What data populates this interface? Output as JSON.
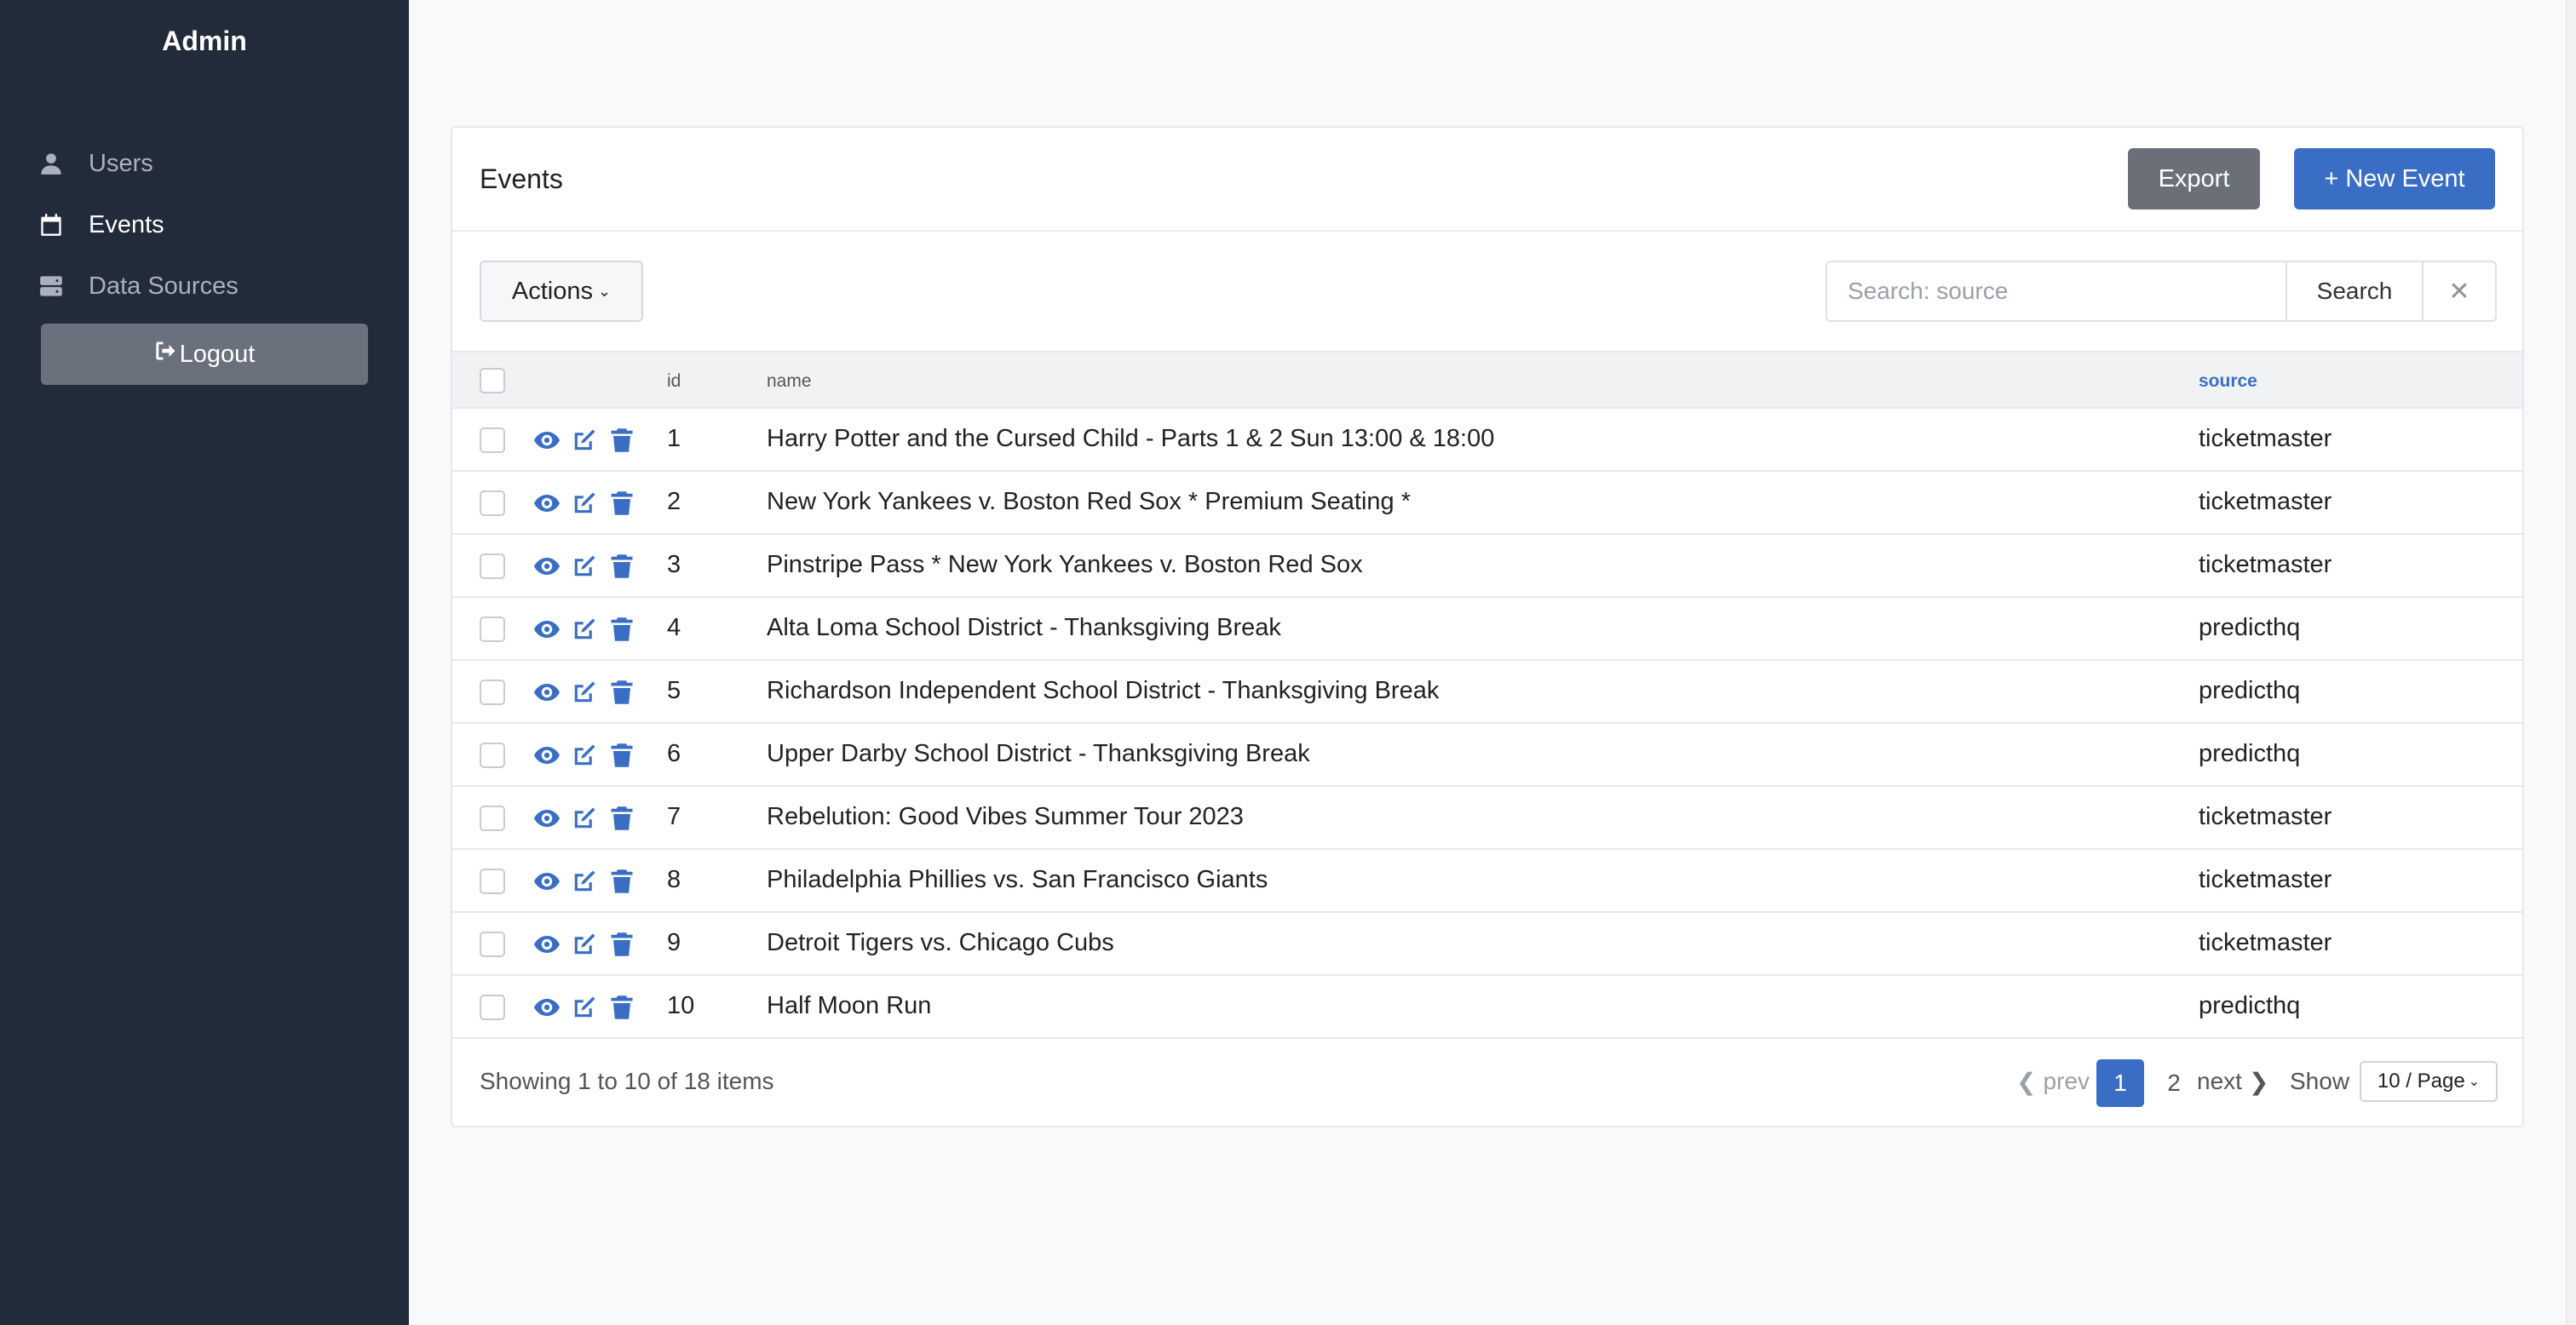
{
  "sidebar": {
    "brand": "Admin",
    "items": [
      {
        "label": "Users",
        "icon": "user-icon"
      },
      {
        "label": "Events",
        "icon": "calendar-icon"
      },
      {
        "label": "Data Sources",
        "icon": "server-icon"
      }
    ],
    "logout_label": "Logout"
  },
  "page": {
    "title": "Events",
    "export_label": "Export",
    "new_label": "+ New Event",
    "actions_label": "Actions",
    "search": {
      "placeholder": "Search: source",
      "button_label": "Search",
      "clear": "✕"
    }
  },
  "table": {
    "columns": {
      "id": "id",
      "name": "name",
      "source": "source"
    },
    "rows": [
      {
        "id": "1",
        "name": "Harry Potter and the Cursed Child - Parts 1 & 2 Sun 13:00 & 18:00",
        "source": "ticketmaster"
      },
      {
        "id": "2",
        "name": "New York Yankees v. Boston Red Sox * Premium Seating *",
        "source": "ticketmaster"
      },
      {
        "id": "3",
        "name": "Pinstripe Pass * New York Yankees v. Boston Red Sox",
        "source": "ticketmaster"
      },
      {
        "id": "4",
        "name": "Alta Loma School District - Thanksgiving Break",
        "source": "predicthq"
      },
      {
        "id": "5",
        "name": "Richardson Independent School District - Thanksgiving Break",
        "source": "predicthq"
      },
      {
        "id": "6",
        "name": "Upper Darby School District - Thanksgiving Break",
        "source": "predicthq"
      },
      {
        "id": "7",
        "name": "Rebelution: Good Vibes Summer Tour 2023",
        "source": "ticketmaster"
      },
      {
        "id": "8",
        "name": "Philadelphia Phillies vs. San Francisco Giants",
        "source": "ticketmaster"
      },
      {
        "id": "9",
        "name": "Detroit Tigers vs. Chicago Cubs",
        "source": "ticketmaster"
      },
      {
        "id": "10",
        "name": "Half Moon Run",
        "source": "predicthq"
      }
    ]
  },
  "footer": {
    "info": "Showing 1 to 10 of 18 items",
    "prev": "prev",
    "pages": [
      "1",
      "2"
    ],
    "current_page": "1",
    "next": "next",
    "show_label": "Show",
    "per_page": "10 / Page"
  },
  "colors": {
    "sidebar_bg": "#222b3a",
    "accent": "#3a6ec4",
    "export_bg": "#6b7078"
  }
}
